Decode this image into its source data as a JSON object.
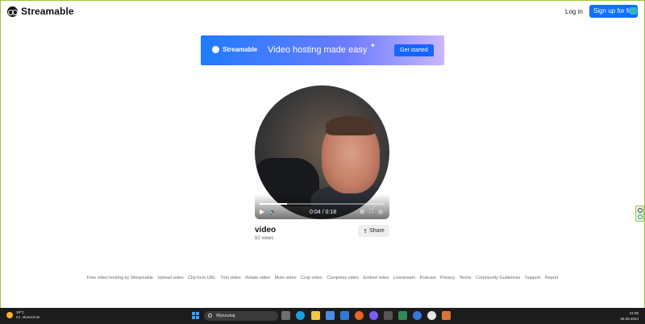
{
  "header": {
    "brand": "Streamable",
    "login": "Log in",
    "signup": "Sign up for free"
  },
  "banner": {
    "brand": "Streamable",
    "tagline": "Video hosting made easy",
    "cta": "Get started"
  },
  "video": {
    "title": "video",
    "views": "82 views",
    "time": "0:04 / 0:18",
    "progress": 0.22,
    "share": "Share"
  },
  "footer": {
    "links": [
      "Free video hosting by Streamable",
      "Upload video",
      "Clip from URL",
      "Trim video",
      "Rotate video",
      "Mute video",
      "Crop video",
      "Compress video",
      "Embed video",
      "Livestream",
      "Podcast",
      "Privacy",
      "Terms",
      "Community Guidelines",
      "Support",
      "Report"
    ]
  },
  "taskbar": {
    "temperature": "19°C",
    "weather": "Cz. słonecznie",
    "search": "Wyszukaj",
    "time": "21:55",
    "date": "05.09.2024"
  },
  "colors": {
    "accent": "#0f6fff",
    "taskbar": "#1c1c1c"
  }
}
